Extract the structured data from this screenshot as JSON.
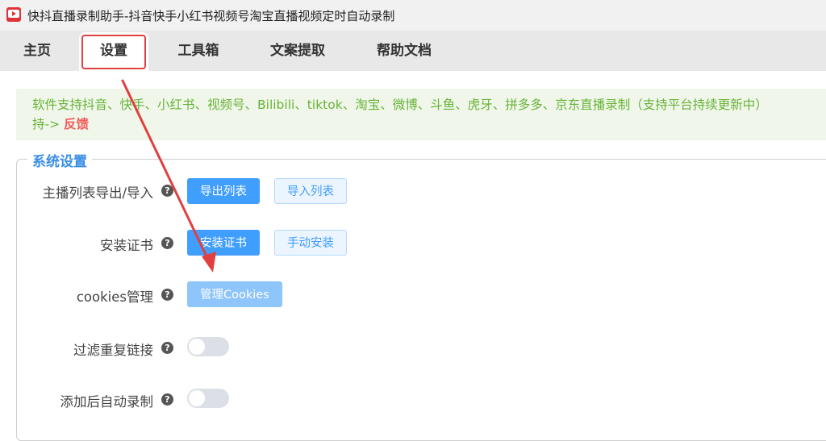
{
  "window": {
    "title": "快抖直播录制助手-抖音快手小红书视频号淘宝直播视频定时自动录制"
  },
  "tabs": [
    {
      "label": "主页"
    },
    {
      "label": "设置",
      "active": true
    },
    {
      "label": "工具箱"
    },
    {
      "label": "文案提取"
    },
    {
      "label": "帮助文档"
    }
  ],
  "notice": {
    "text_line1": "软件支持抖音、快手、小红书、视频号、Bilibili、tiktok、淘宝、微博、斗鱼、虎牙、拼多多、京东直播录制（支持平台持续更新中）",
    "text_line2": "持->",
    "feedback_link": "反馈"
  },
  "settings": {
    "section_title": "系统设置",
    "rows": [
      {
        "label": "主播列表导出/导入",
        "buttons": [
          "导出列表",
          "导入列表"
        ]
      },
      {
        "label": "安装证书",
        "buttons": [
          "安装证书",
          "手动安装"
        ]
      },
      {
        "label": "cookies管理",
        "buttons": [
          "管理Cookies"
        ]
      },
      {
        "label": "过滤重复链接",
        "toggle": false
      },
      {
        "label": "添加后自动录制",
        "toggle": false
      }
    ],
    "help_glyph": "?"
  },
  "colors": {
    "accent": "#409eff",
    "notice_text": "#67b337",
    "feedback": "#f25b5b",
    "section_title": "#3a8ee6",
    "annotation": "#e04040"
  }
}
